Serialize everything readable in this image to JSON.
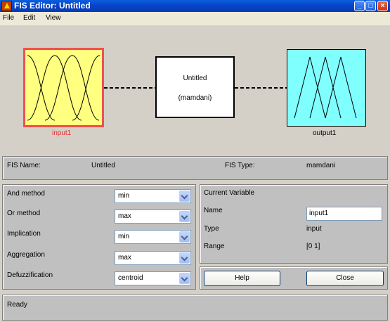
{
  "window": {
    "title": "FIS Editor: Untitled"
  },
  "menu": [
    {
      "label": "File"
    },
    {
      "label": "Edit"
    },
    {
      "label": "View"
    }
  ],
  "diagram": {
    "input": {
      "label": "input1"
    },
    "system": {
      "name": "Untitled",
      "type": "(mamdani)"
    },
    "output": {
      "label": "output1"
    }
  },
  "info": {
    "fis_name_label": "FIS Name:",
    "fis_name_value": "Untitled",
    "fis_type_label": "FIS Type:",
    "fis_type_value": "mamdani"
  },
  "methods": [
    {
      "label": "And method",
      "value": "min"
    },
    {
      "label": "Or method",
      "value": "max"
    },
    {
      "label": "Implication",
      "value": "min"
    },
    {
      "label": "Aggregation",
      "value": "max"
    },
    {
      "label": "Defuzzification",
      "value": "centroid"
    }
  ],
  "current_variable": {
    "title": "Current Variable",
    "name_label": "Name",
    "name_value": "input1",
    "type_label": "Type",
    "type_value": "input",
    "range_label": "Range",
    "range_value": "[0 1]"
  },
  "buttons": {
    "help": "Help",
    "close": "Close"
  },
  "status": "Ready",
  "colors": {
    "input_fill": "#ffff80",
    "input_selected_border": "#ef5050",
    "output_fill": "#80ffff",
    "title_bar": "#0a5fe0"
  }
}
